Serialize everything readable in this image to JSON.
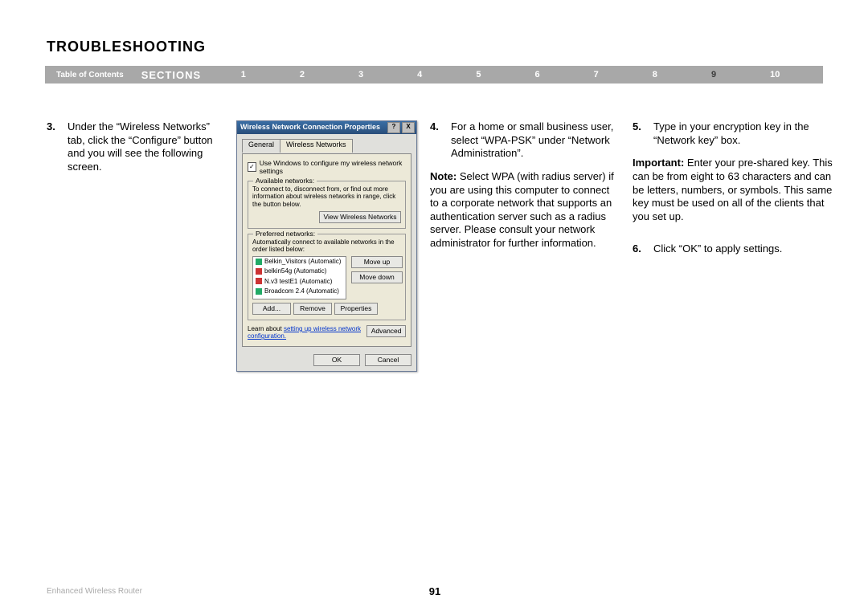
{
  "title": "TROUBLESHOOTING",
  "nav": {
    "toc": "Table of Contents",
    "sections": "SECTIONS",
    "links": [
      "1",
      "2",
      "3",
      "4",
      "5",
      "6",
      "7",
      "8",
      "9",
      "10"
    ],
    "active_index": 8
  },
  "steps": {
    "s3": {
      "n": "3.",
      "t": "Under the “Wireless Networks” tab, click the “Configure” button and you will see the following screen."
    },
    "s4": {
      "n": "4.",
      "t": "For a home or small business user, select “WPA-PSK” under “Network Administration”."
    },
    "note4": {
      "label": "Note:",
      "t": " Select WPA (with radius server) if you are using this computer to connect to a corporate network that supports an authentication server such as a radius server. Please consult your network administrator for further information."
    },
    "s5": {
      "n": "5.",
      "t": "Type in your encryption key in the “Network key” box."
    },
    "imp5": {
      "label": "Important:",
      "t": " Enter your pre-shared key. This can be from eight to 63 characters and can be letters, numbers, or symbols. This same key must be used on all of the clients that you set up."
    },
    "s6": {
      "n": "6.",
      "t": "Click “OK” to apply settings."
    }
  },
  "dialog": {
    "title": "Wireless Network Connection Properties",
    "help": "?",
    "close": "X",
    "tabs": {
      "general": "General",
      "wn": "Wireless Networks"
    },
    "chk": "Use Windows to configure my wireless network settings",
    "avail": {
      "label": "Available networks:",
      "desc": "To connect to, disconnect from, or find out more information about wireless networks in range, click the button below.",
      "view": "View Wireless Networks"
    },
    "pref": {
      "label": "Preferred networks:",
      "desc": "Automatically connect to available networks in the order listed below:",
      "items": [
        "Belkin_Visitors (Automatic)",
        "belkin54g (Automatic)",
        "N.v3 testE1 (Automatic)",
        "Broadcom 2.4 (Automatic)"
      ],
      "moveup": "Move up",
      "movedown": "Move down",
      "add": "Add...",
      "remove": "Remove",
      "props": "Properties"
    },
    "learn": "Learn about ",
    "learn_link": "setting up wireless network configuration.",
    "advanced": "Advanced",
    "ok": "OK",
    "cancel": "Cancel"
  },
  "footer": {
    "left": "Enhanced Wireless Router",
    "page": "91"
  }
}
